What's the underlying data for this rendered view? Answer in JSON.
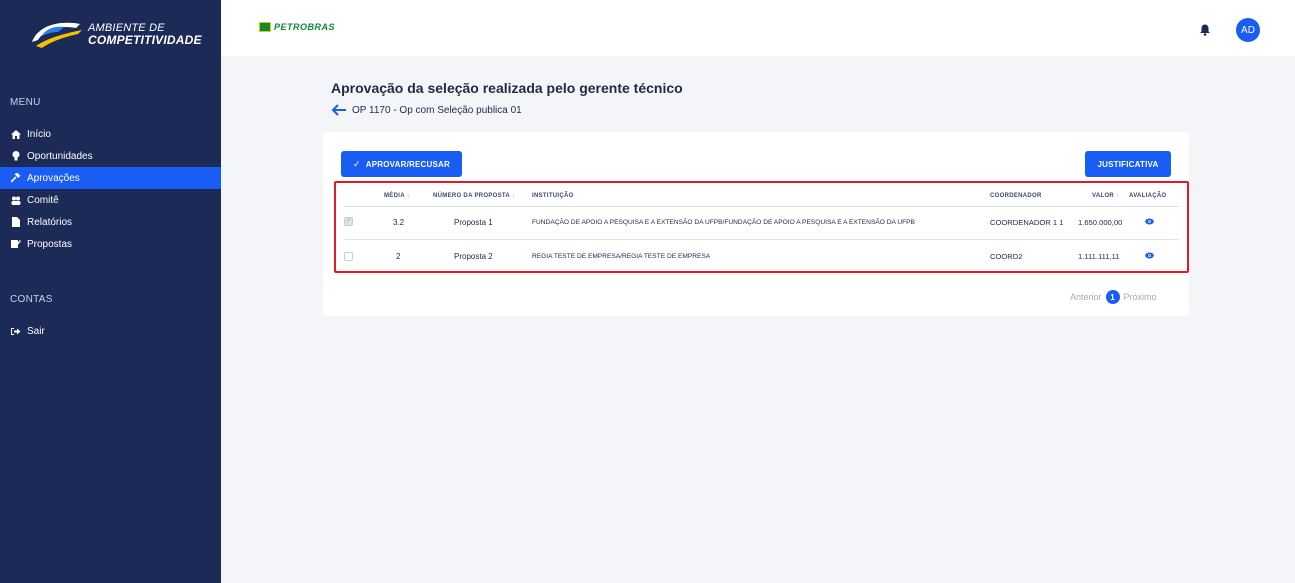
{
  "logo": {
    "line1": "AMBIENTE DE",
    "line2": "COMPETITIVIDADE"
  },
  "header": {
    "brand": "PETROBRAS",
    "avatar_initials": "AD",
    "notification_icon": "bell-icon"
  },
  "sidebar": {
    "menu_label": "MENU",
    "items": [
      {
        "label": "Início",
        "icon": "home-icon",
        "active": false
      },
      {
        "label": "Oportunidades",
        "icon": "lightbulb-icon",
        "active": false
      },
      {
        "label": "Aprovações",
        "icon": "gavel-icon",
        "active": true
      },
      {
        "label": "Comitê",
        "icon": "group-icon",
        "active": false
      },
      {
        "label": "Relatórios",
        "icon": "file-icon",
        "active": false
      },
      {
        "label": "Propostas",
        "icon": "edit-icon",
        "active": false
      }
    ],
    "accounts_label": "CONTAS",
    "logout": {
      "label": "Sair",
      "icon": "logout-icon"
    }
  },
  "page": {
    "title": "Aprovação da seleção realizada pelo gerente técnico",
    "breadcrumb": "OP 1170 - Op com Seleção publica 01"
  },
  "actions": {
    "approve_label": "APROVAR/RECUSAR",
    "justify_label": "JUSTIFICATIVA"
  },
  "table": {
    "columns": [
      "MÉDIA",
      "NÚMERO DA PROPOSTA",
      "INSTITUIÇÃO",
      "COORDENADOR",
      "VALOR",
      "AVALIAÇÃO"
    ],
    "sort_glyph": "↕",
    "rows": [
      {
        "checked": true,
        "media": "3.2",
        "proposta": "Proposta 1",
        "instituicao": "FUNDAÇÃO DE APOIO A PESQUISA E A EXTENSÃO DA UFPB/FUNDAÇÃO DE APOIO A PESQUISA E A EXTENSÃO DA UFPB",
        "coordenador": "COORDENADOR 1 1",
        "valor": "1.650.000,00"
      },
      {
        "checked": false,
        "media": "2",
        "proposta": "Proposta 2",
        "instituicao": "REGIA TESTE DE EMPRESA/REGIA TESTE DE EMPRESA",
        "coordenador": "COORD2",
        "valor": "1.111.111,11"
      }
    ]
  },
  "pagination": {
    "prev": "Anterior",
    "current": "1",
    "next": "Próximo"
  },
  "colors": {
    "sidebar": "#1b2a57",
    "accent": "#1a5df5",
    "highlight_border": "#e31b23",
    "brand_green": "#0b8a3a"
  }
}
